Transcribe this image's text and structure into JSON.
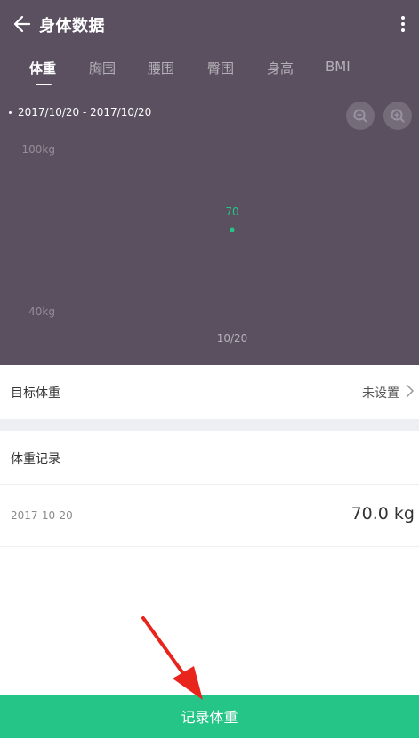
{
  "header": {
    "title": "身体数据",
    "back_icon": "back-arrow-icon",
    "more_icon": "more-vertical-icon"
  },
  "tabs": [
    {
      "label": "体重",
      "active": true
    },
    {
      "label": "胸围",
      "active": false
    },
    {
      "label": "腰围",
      "active": false
    },
    {
      "label": "臀围",
      "active": false
    },
    {
      "label": "身高",
      "active": false
    },
    {
      "label": "BMI",
      "active": false
    }
  ],
  "chart_header": {
    "date_range": "2017/10/20 - 2017/10/20",
    "zoom_out_icon": "zoom-out-icon",
    "zoom_in_icon": "zoom-in-icon"
  },
  "chart_data": {
    "type": "scatter",
    "ylim": [
      40,
      100
    ],
    "y_tick_labels": [
      "100kg",
      "40kg"
    ],
    "x_tick_labels": [
      "10/20"
    ],
    "points": [
      {
        "x": "10/20",
        "y": 70,
        "label": "70"
      }
    ],
    "point_color": "#25c587",
    "grid": false
  },
  "target_weight": {
    "label": "目标体重",
    "value": "未设置"
  },
  "records": {
    "title": "体重记录",
    "items": [
      {
        "date": "2017-10-20",
        "value": "70.0 kg"
      }
    ]
  },
  "bottom_button": {
    "label": "记录体重"
  },
  "colors": {
    "header_bg": "#5a5060",
    "accent": "#25c587",
    "annotation_arrow": "#e8241c"
  }
}
